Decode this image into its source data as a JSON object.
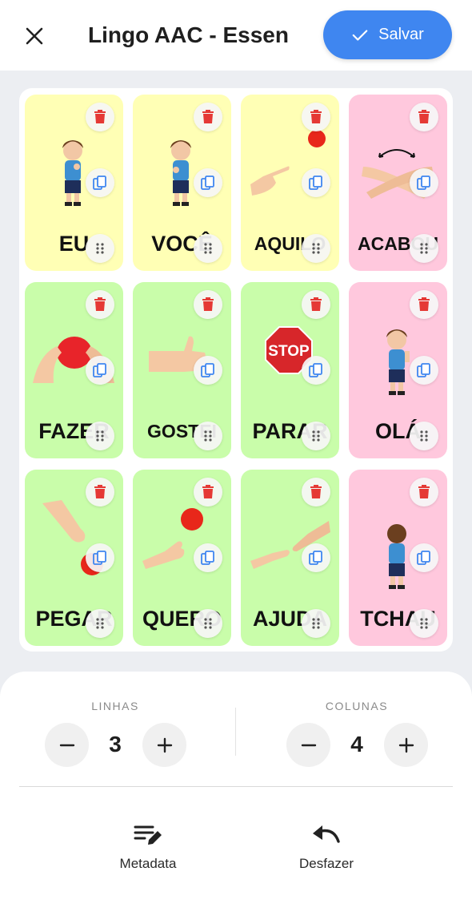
{
  "header": {
    "close_icon": "close-icon",
    "title": "Lingo AAC - Essen",
    "save_label": "Salvar"
  },
  "colors": {
    "yellow": "#ffffb5",
    "green": "#c9fdaa",
    "pink": "#ffc8dd",
    "accent": "#3f86f0",
    "delete": "#e53935"
  },
  "tiles": [
    {
      "word": "EU",
      "color": "yellow"
    },
    {
      "word": "VOCÊ",
      "color": "yellow"
    },
    {
      "word": "AQUILO",
      "color": "yellow"
    },
    {
      "word": "ACABOU",
      "color": "pink"
    },
    {
      "word": "FAZER",
      "color": "green"
    },
    {
      "word": "GOSTEI",
      "color": "green"
    },
    {
      "word": "PARAR",
      "color": "green"
    },
    {
      "word": "OLÁ",
      "color": "pink"
    },
    {
      "word": "PEGAR",
      "color": "green"
    },
    {
      "word": "QUERO",
      "color": "green"
    },
    {
      "word": "AJUDA",
      "color": "green"
    },
    {
      "word": "TCHAU",
      "color": "pink"
    }
  ],
  "stop_sign_text": "STOP",
  "controls": {
    "rows": {
      "label": "LINHAS",
      "value": "3"
    },
    "columns": {
      "label": "COLUNAS",
      "value": "4"
    },
    "minus_icon": "minus-icon",
    "plus_icon": "plus-icon"
  },
  "actions": {
    "metadata": {
      "label": "Metadata",
      "icon": "edit-list-icon"
    },
    "undo": {
      "label": "Desfazer",
      "icon": "undo-icon"
    }
  }
}
